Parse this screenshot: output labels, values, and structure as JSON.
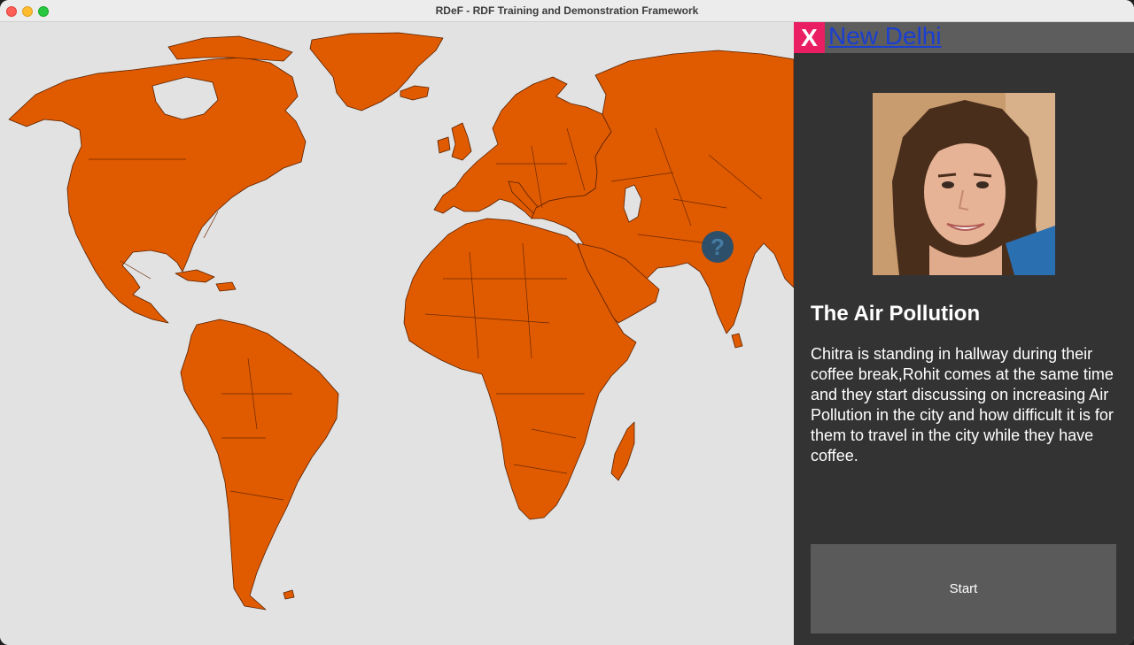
{
  "window": {
    "title": "RDeF - RDF Training and Demonstration Framework"
  },
  "map": {
    "marker_glyph": "?",
    "land_color": "#e05a00",
    "ocean_color": "#e2e2e2",
    "marker_color": "#1f4f74"
  },
  "panel": {
    "close_label": "X",
    "city": "New Delhi",
    "title": "The Air Pollution",
    "description": "Chitra is standing in hallway during their coffee break,Rohit comes at the same time and they start discussing on increasing Air Pollution in the city and how difficult it is for them to travel in the city while they have coffee.",
    "start_label": "Start"
  }
}
